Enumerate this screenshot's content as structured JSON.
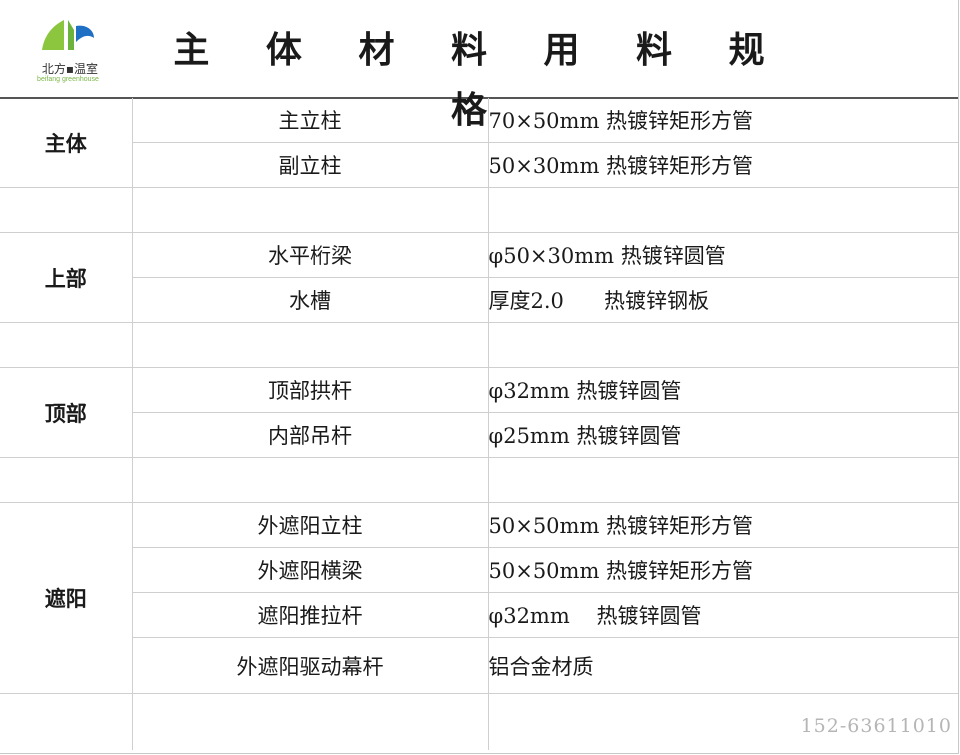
{
  "logo": {
    "cn": "北方▪温室",
    "en": "beifang greenhouse",
    "colors": {
      "green": "#8cc63f",
      "blue": "#1f6fc4"
    }
  },
  "title": "主 体 材 料 用 料 规 格",
  "groups": [
    {
      "label": "主体",
      "rows": [
        {
          "name": "主立柱",
          "spec": "70×50mm 热镀锌矩形方管"
        },
        {
          "name": "副立柱",
          "spec": "50×30mm 热镀锌矩形方管"
        }
      ]
    },
    {
      "label": "上部",
      "rows": [
        {
          "name": "水平桁梁",
          "spec": "φ50×30mm 热镀锌圆管"
        },
        {
          "name": "水槽",
          "spec": "厚度2.0      热镀锌钢板"
        }
      ]
    },
    {
      "label": "顶部",
      "rows": [
        {
          "name": "顶部拱杆",
          "spec": "φ32mm 热镀锌圆管"
        },
        {
          "name": "内部吊杆",
          "spec": "φ25mm 热镀锌圆管"
        }
      ]
    },
    {
      "label": "遮阳",
      "rows": [
        {
          "name": "外遮阳立柱",
          "spec": "50×50mm 热镀锌矩形方管"
        },
        {
          "name": "外遮阳横梁",
          "spec": "50×50mm 热镀锌矩形方管"
        },
        {
          "name": "遮阳推拉杆",
          "spec": "φ32mm    热镀锌圆管"
        },
        {
          "name": "外遮阳驱动幕杆",
          "spec": "铝合金材质"
        }
      ]
    }
  ],
  "phone": "152-63611010"
}
